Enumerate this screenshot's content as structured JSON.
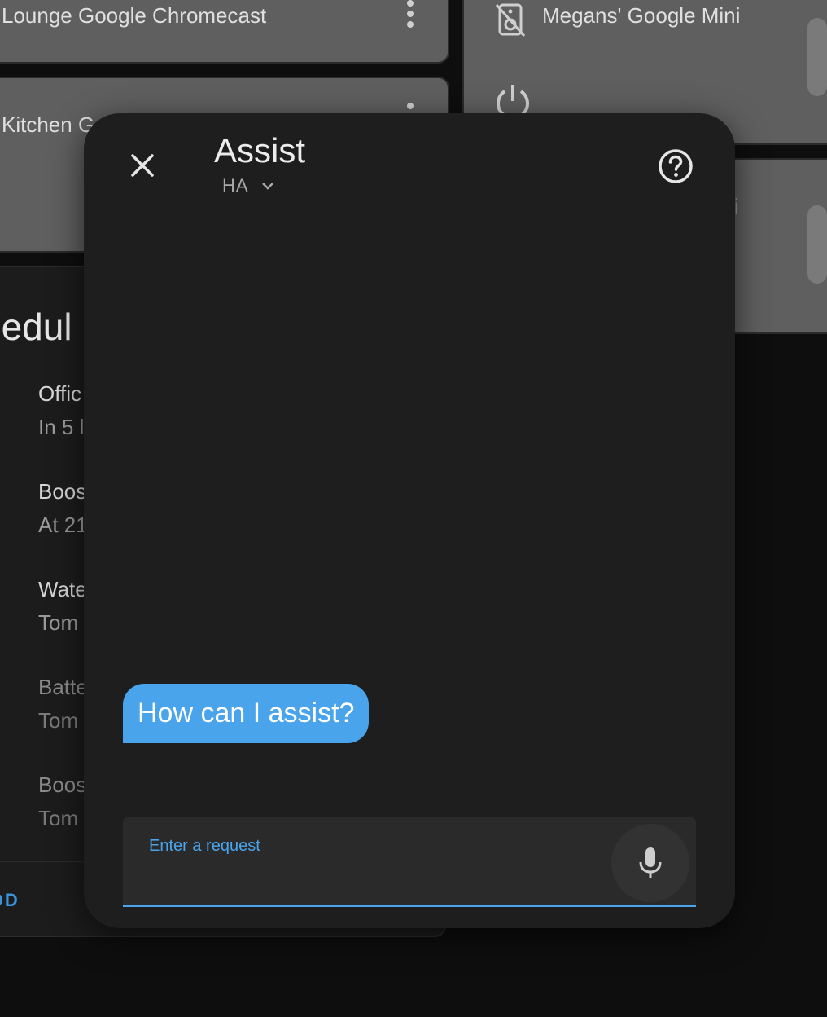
{
  "background": {
    "cards": {
      "lounge": "Lounge Google Chromecast",
      "kitchen": "Kitchen Go",
      "megans": "Megans' Google Mini",
      "partial_right": "i"
    },
    "schedule": {
      "title": "hedul",
      "items": [
        {
          "a": "Offic",
          "b": "In 5 l"
        },
        {
          "a": "Boos",
          "b": "At 21"
        },
        {
          "a": "Wate",
          "b": "Tom"
        },
        {
          "a": "Batte",
          "b": "Tom"
        },
        {
          "a": "Boos",
          "b": "Tom"
        }
      ],
      "add": "DD"
    }
  },
  "dialog": {
    "title": "Assist",
    "pipeline": "HA",
    "message": "How can I assist?",
    "input": {
      "label": "Enter a request",
      "value": ""
    }
  },
  "colors": {
    "accent": "#4aa4ec",
    "dialog_bg": "#1e1e1f",
    "card_bg": "#5f5f5f"
  },
  "icons": {
    "close": "close-icon",
    "help": "help-circle-icon",
    "chevron": "chevron-down-icon",
    "mic": "microphone-icon",
    "kebab": "more-vertical-icon",
    "speaker_off": "speaker-off-icon",
    "power": "power-icon"
  }
}
